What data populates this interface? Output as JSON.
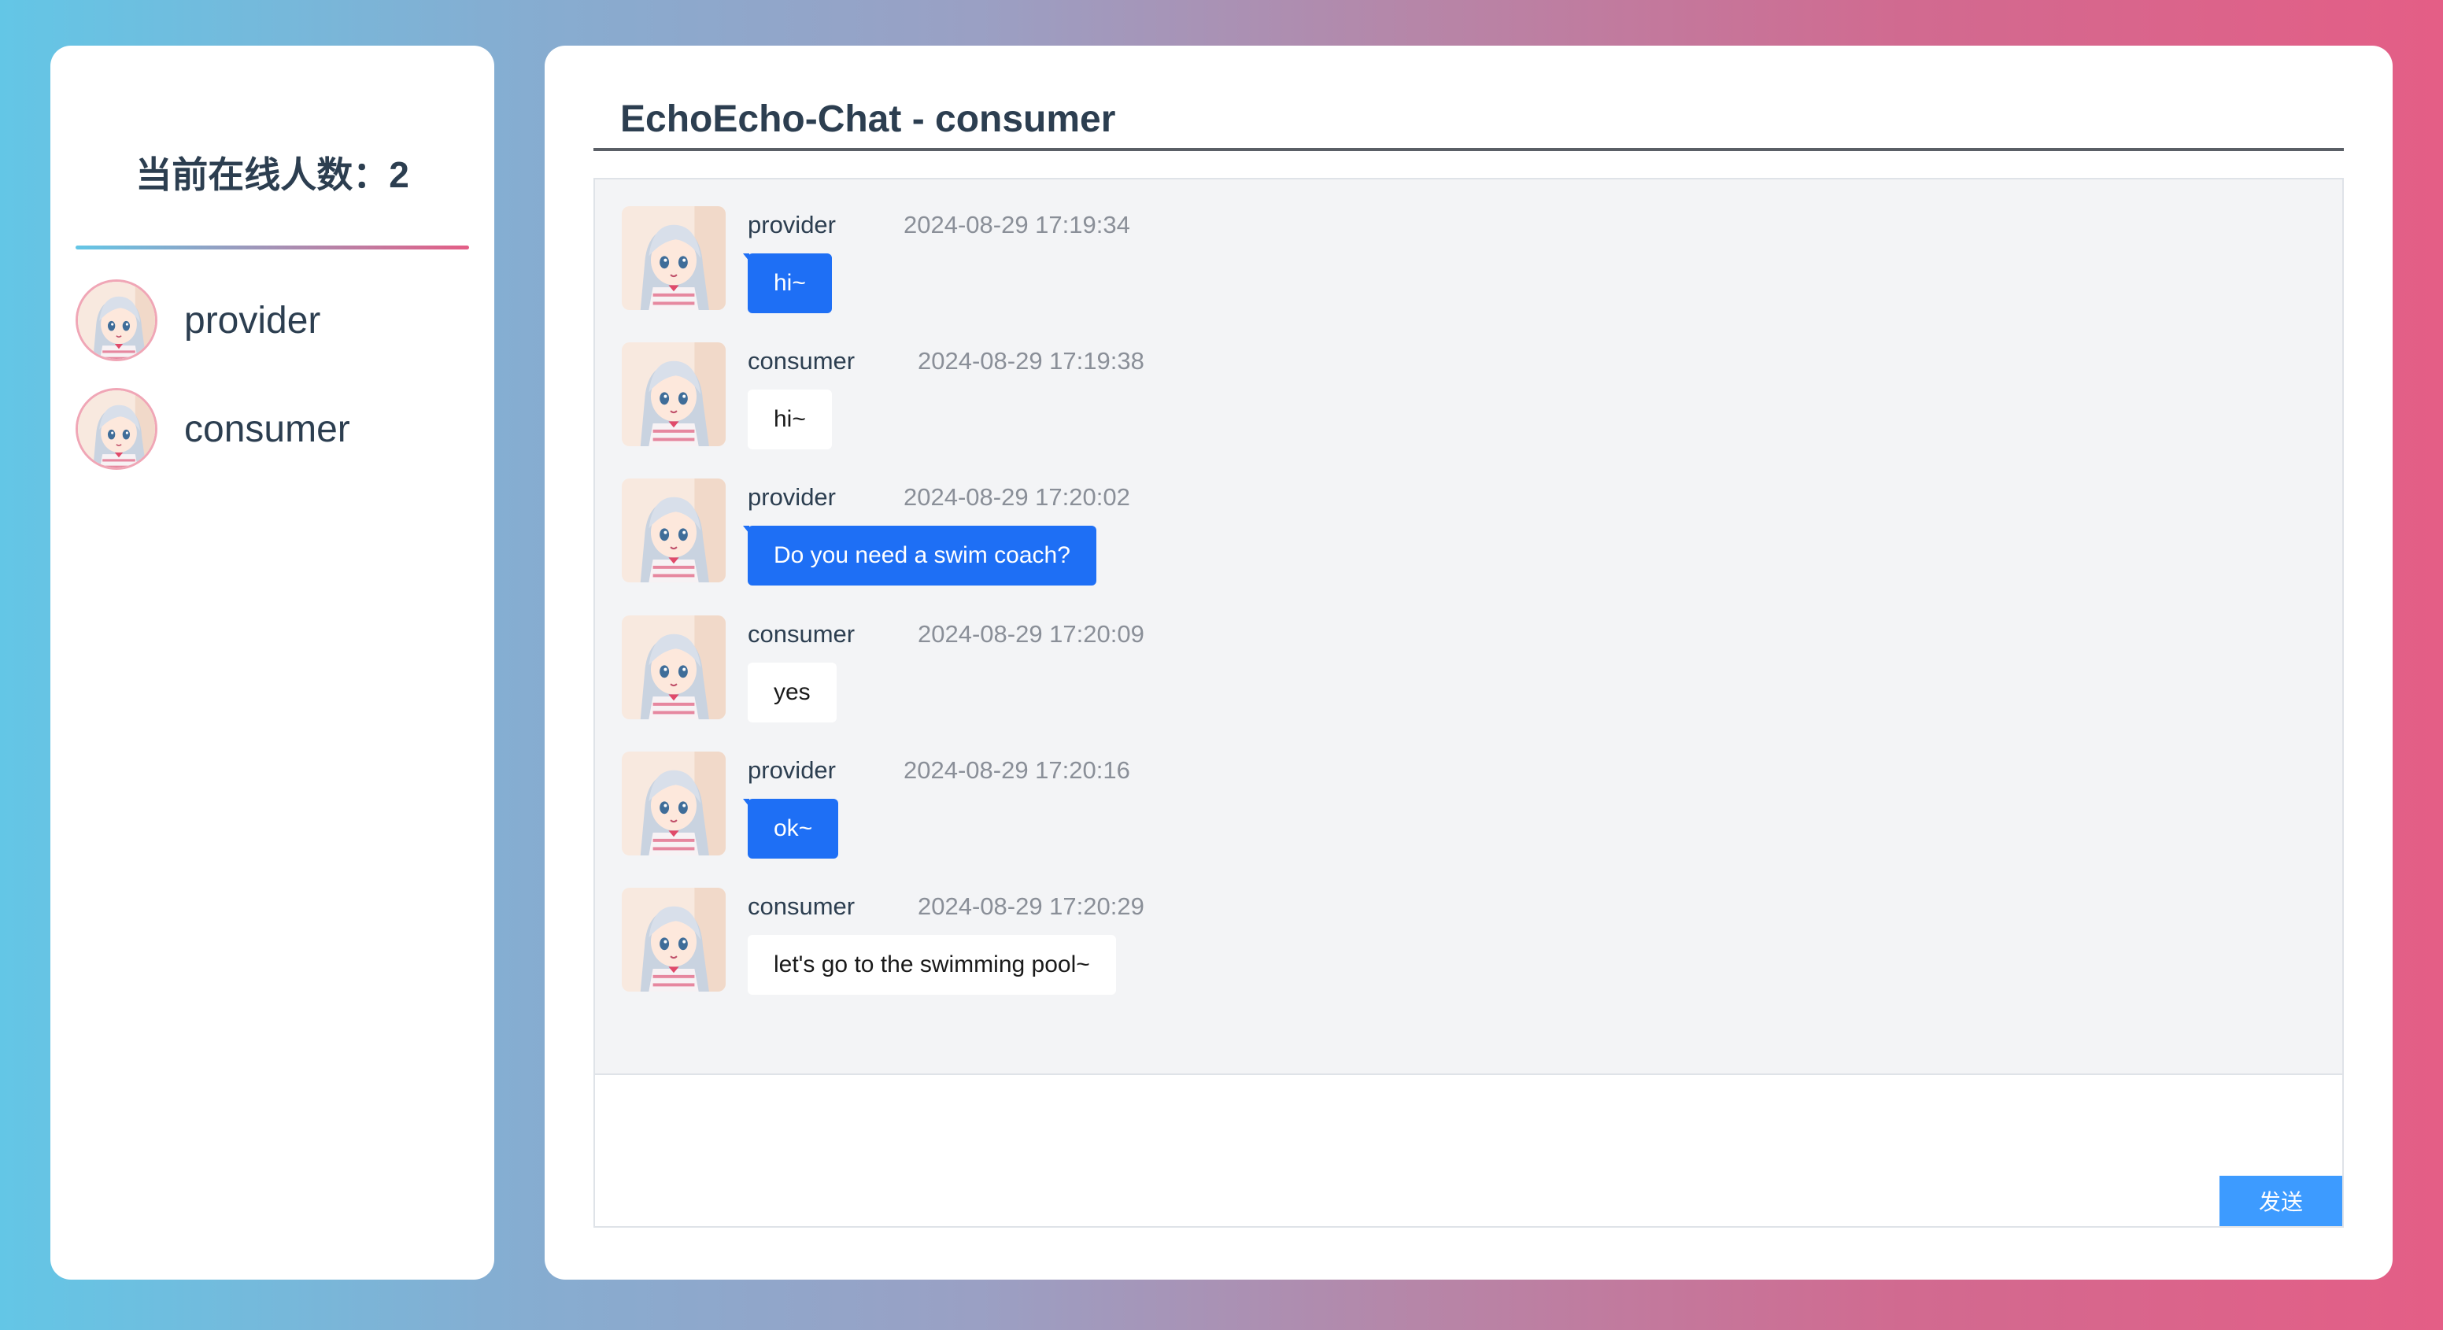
{
  "sidebar": {
    "online_label": "当前在线人数：2",
    "users": [
      {
        "name": "provider"
      },
      {
        "name": "consumer"
      }
    ]
  },
  "chat": {
    "title": "EchoEcho-Chat - consumer",
    "messages": [
      {
        "sender": "provider",
        "time": "2024-08-29 17:19:34",
        "text": "hi~",
        "role": "provider"
      },
      {
        "sender": "consumer",
        "time": "2024-08-29 17:19:38",
        "text": "hi~",
        "role": "consumer"
      },
      {
        "sender": "provider",
        "time": "2024-08-29 17:20:02",
        "text": "Do you need a swim coach?",
        "role": "provider"
      },
      {
        "sender": "consumer",
        "time": "2024-08-29 17:20:09",
        "text": "yes",
        "role": "consumer"
      },
      {
        "sender": "provider",
        "time": "2024-08-29 17:20:16",
        "text": "ok~",
        "role": "provider"
      },
      {
        "sender": "consumer",
        "time": "2024-08-29 17:20:29",
        "text": "let's go to the swimming pool~",
        "role": "consumer"
      }
    ],
    "input_value": "",
    "send_label": "发送"
  },
  "colors": {
    "provider_bubble": "#1e6ff5",
    "consumer_bubble": "#ffffff",
    "send_button": "#3d9bff",
    "gradient_start": "#63c6e6",
    "gradient_end": "#e45e86"
  },
  "icons": {
    "avatar": "anime-girl-avatar-icon"
  }
}
